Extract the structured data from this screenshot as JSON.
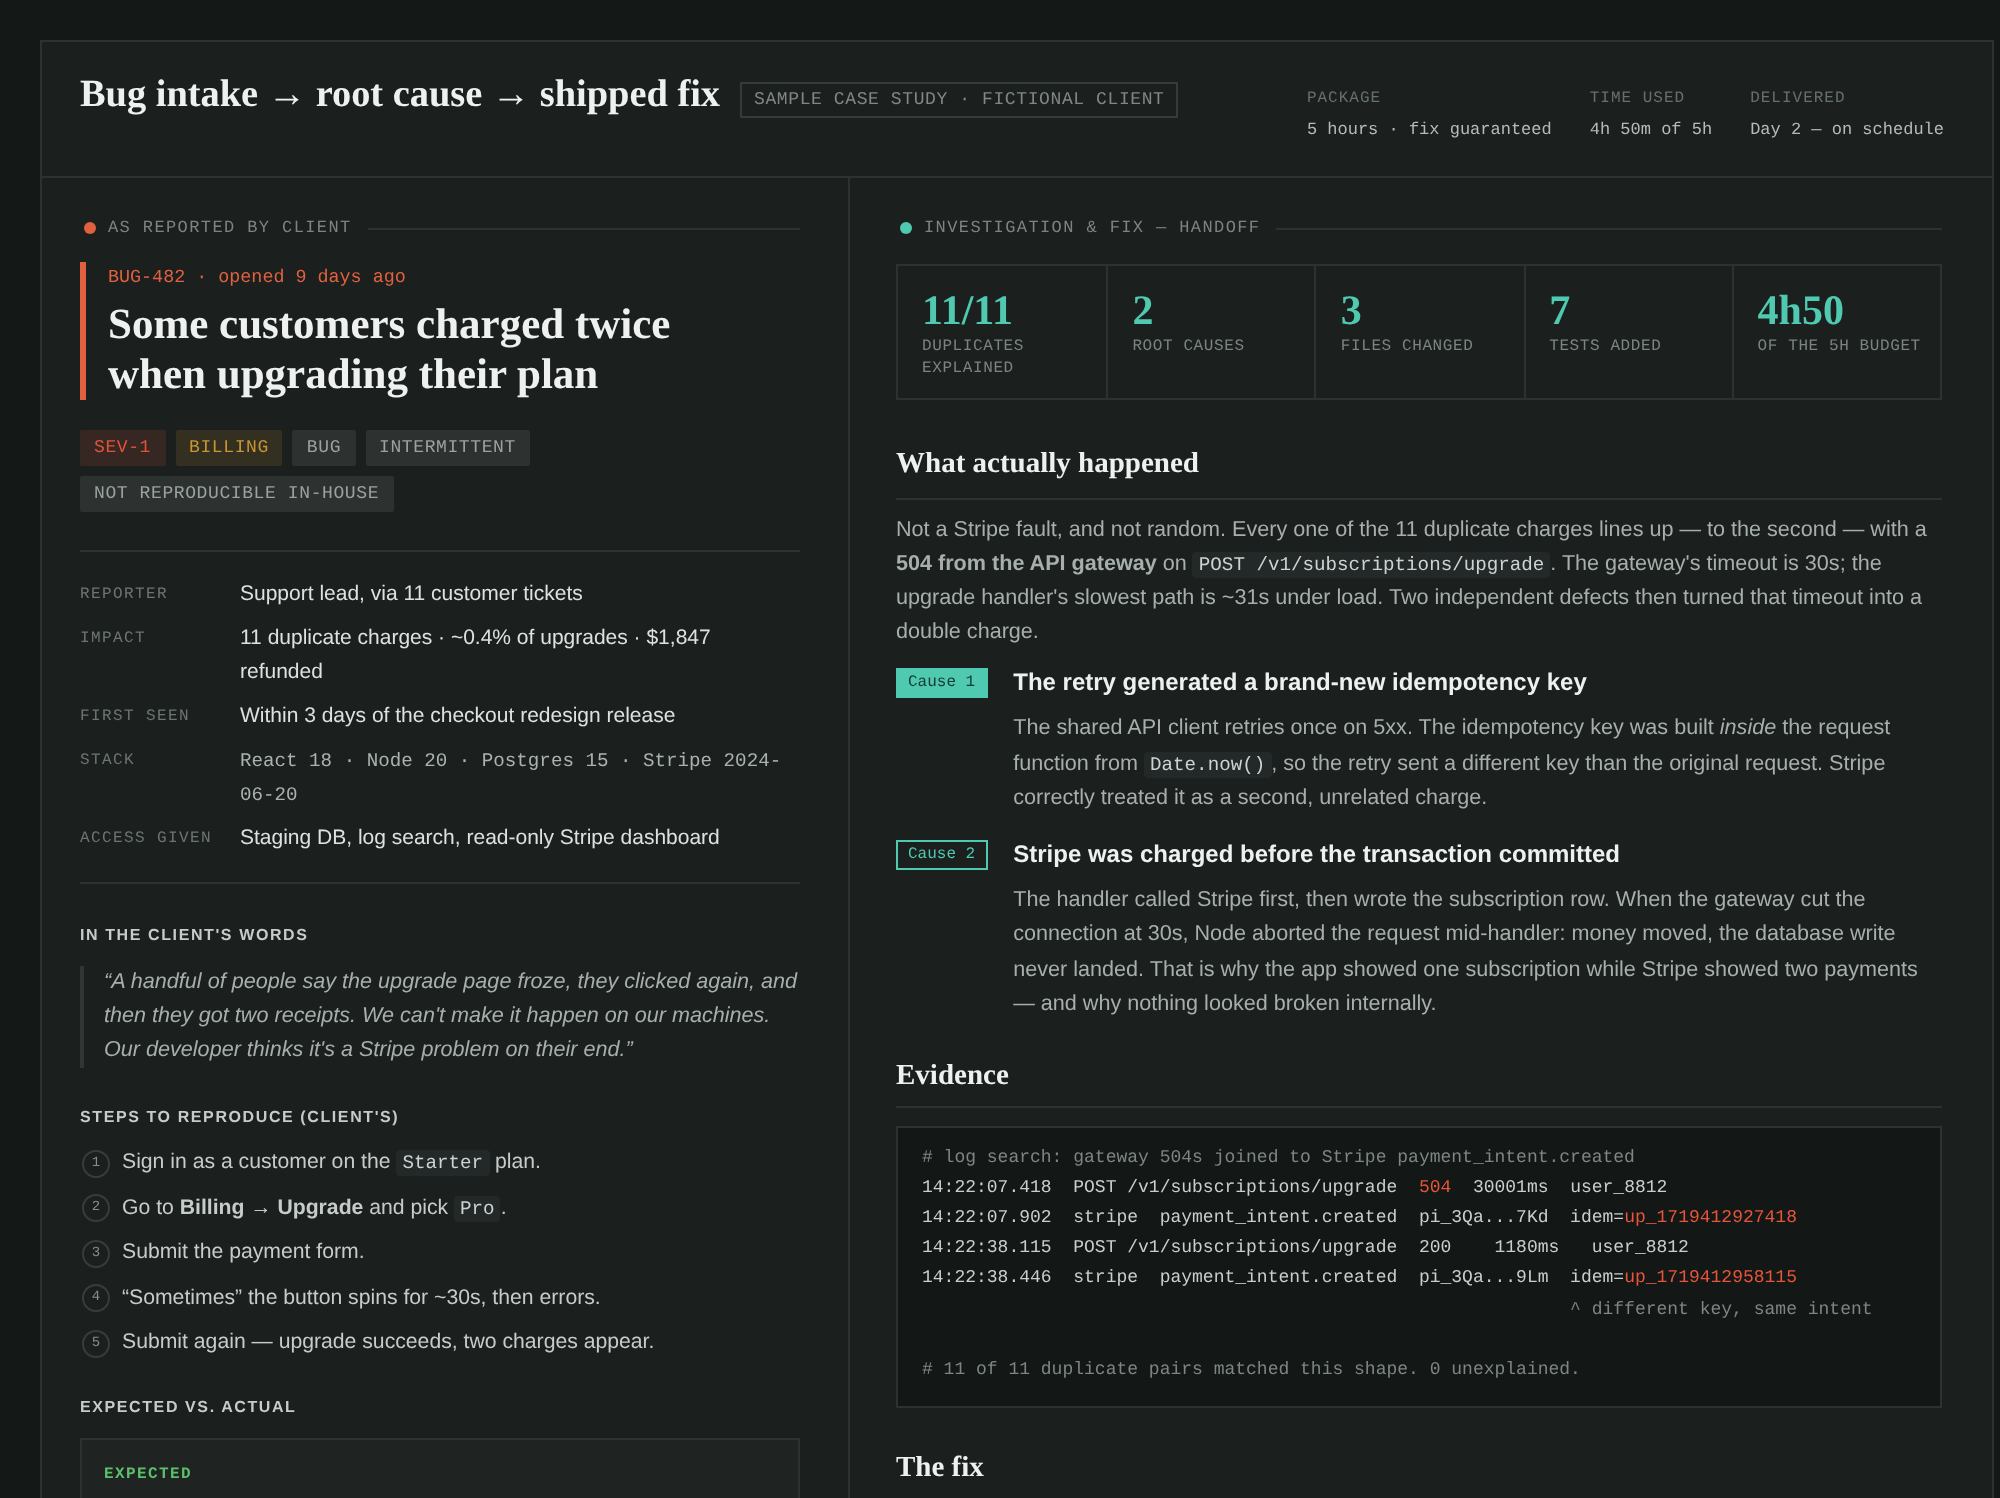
{
  "header": {
    "title": "Bug intake → root cause → shipped fix",
    "badge": "SAMPLE CASE STUDY · FICTIONAL CLIENT",
    "meta": [
      {
        "label": "PACKAGE",
        "value": "5 hours · fix guaranteed"
      },
      {
        "label": "TIME USED",
        "value": "4h 50m of 5h"
      },
      {
        "label": "DELIVERED",
        "value": "Day 2 — on schedule"
      }
    ]
  },
  "report": {
    "section_label": "AS REPORTED BY CLIENT",
    "bug_meta": "BUG-482 · opened 9 days ago",
    "bug_title": "Some customers charged twice when upgrading their plan",
    "tags": [
      {
        "label": "SEV-1",
        "color": "#e0533a"
      },
      {
        "label": "BILLING",
        "color": "#c9962f"
      },
      {
        "label": "BUG",
        "color": "#9aa39f"
      },
      {
        "label": "INTERMITTENT",
        "color": "#9aa39f"
      },
      {
        "label": "NOT REPRODUCIBLE IN-HOUSE",
        "color": "#9aa39f"
      }
    ],
    "fields": [
      {
        "label": "REPORTER",
        "value": "Support lead, via 11 customer tickets",
        "kind": "text"
      },
      {
        "label": "IMPACT",
        "value": "11 duplicate charges · ~0.4% of upgrades · $1,847 refunded",
        "kind": "text"
      },
      {
        "label": "FIRST SEEN",
        "value": "Within 3 days of the checkout redesign release",
        "kind": "text"
      },
      {
        "label": "STACK",
        "value": "React 18 · Node 20 · Postgres 15 · Stripe 2024-06-20",
        "kind": "mono"
      },
      {
        "label": "ACCESS GIVEN",
        "value": "Staging DB, log search, read-only Stripe dashboard",
        "kind": "text"
      }
    ],
    "quote_heading": "IN THE CLIENT'S WORDS",
    "quote": "“A handful of people say the upgrade page froze, they clicked again, and then they got two receipts. We can't make it happen on our machines. Our developer thinks it's a Stripe problem on their end.”",
    "steps_heading": "STEPS TO REPRODUCE (CLIENT'S)",
    "steps": [
      {
        "number": "1",
        "parts": [
          {
            "kind": "text",
            "text": "Sign in as a customer on the "
          },
          {
            "kind": "code",
            "text": "Starter"
          },
          {
            "kind": "text",
            "text": " plan."
          }
        ]
      },
      {
        "number": "2",
        "parts": [
          {
            "kind": "text",
            "text": "Go to **Billing → Upgrade** and pick "
          },
          {
            "kind": "code",
            "text": "Pro"
          },
          {
            "kind": "text",
            "text": "."
          }
        ]
      },
      {
        "number": "3",
        "parts": [
          {
            "kind": "text",
            "text": "Submit the payment form."
          }
        ]
      },
      {
        "number": "4",
        "parts": [
          {
            "kind": "text",
            "text": "“Sometimes” the button spins for ~30s, then errors."
          }
        ]
      },
      {
        "number": "5",
        "parts": [
          {
            "kind": "text",
            "text": "Submit again — upgrade succeeds, two charges appear."
          }
        ]
      }
    ],
    "expected_heading": "EXPECTED VS. ACTUAL",
    "expected_label": "EXPECTED"
  },
  "investigation": {
    "section_label": "INVESTIGATION & FIX — HANDOFF",
    "stats": [
      {
        "value": "11/11",
        "label": "DUPLICATES EXPLAINED"
      },
      {
        "value": "2",
        "label": "ROOT CAUSES"
      },
      {
        "value": "3",
        "label": "FILES CHANGED"
      },
      {
        "value": "7",
        "label": "TESTS ADDED"
      },
      {
        "value": "4h50",
        "label": "OF THE 5H BUDGET"
      }
    ],
    "summary_heading": "What actually happened",
    "summary": [
      {
        "kind": "text",
        "text": "Not a Stripe fault, and not random. Every one of the 11 duplicate charges lines up — to the second — with a **504 from the API gateway** on "
      },
      {
        "kind": "code",
        "text": "POST /v1/subscriptions/upgrade"
      },
      {
        "kind": "text",
        "text": ". The gateway's timeout is 30s; the upgrade handler's slowest path is ~31s under load. Two independent defects then turned that timeout into a double charge."
      }
    ],
    "causes": [
      {
        "badge": "Cause 1",
        "kind": "filled",
        "title": "The retry generated a brand-new idempotency key",
        "body": [
          {
            "kind": "text",
            "text": "The shared API client retries once on 5xx. The idempotency key was built *inside* the request function from "
          },
          {
            "kind": "code",
            "text": "Date.now()"
          },
          {
            "kind": "text",
            "text": ", so the retry sent a different key than the original request. Stripe correctly treated it as a second, unrelated charge."
          }
        ]
      },
      {
        "badge": "Cause 2",
        "kind": "outline",
        "title": "Stripe was charged before the transaction committed",
        "body": [
          {
            "kind": "text",
            "text": "The handler called Stripe first, then wrote the subscription row. When the gateway cut the connection at 30s, Node aborted the request mid-handler: money moved, the database write never landed. That is why the app showed one subscription while Stripe showed two payments — and why nothing looked broken internally."
          }
        ]
      }
    ],
    "evidence_heading": "Evidence",
    "log": [
      {
        "kind": "comment",
        "parts": [
          {
            "text": "# log search: gateway 504s joined to Stripe payment_intent.created",
            "alert": false
          }
        ]
      },
      {
        "kind": "entry",
        "parts": [
          {
            "text": "14:22:07.418  POST /v1/subscriptions/upgrade  ",
            "alert": false
          },
          {
            "text": "504",
            "alert": true
          },
          {
            "text": "  30001ms  user_8812",
            "alert": false
          }
        ]
      },
      {
        "kind": "entry",
        "parts": [
          {
            "text": "14:22:07.902  stripe  payment_intent.created  pi_3Qa...7Kd  idem=",
            "alert": false
          },
          {
            "text": "up_1719412927418",
            "alert": true
          }
        ]
      },
      {
        "kind": "entry",
        "parts": [
          {
            "text": "14:22:38.115  POST /v1/subscriptions/upgrade  200    1180ms   user_8812",
            "alert": false
          }
        ]
      },
      {
        "kind": "entry",
        "parts": [
          {
            "text": "14:22:38.446  stripe  payment_intent.created  pi_3Qa...9Lm  idem=",
            "alert": false
          },
          {
            "text": "up_1719412958115",
            "alert": true
          }
        ]
      },
      {
        "kind": "note",
        "parts": [
          {
            "text": "^ different key, same intent",
            "alert": false
          }
        ]
      },
      {
        "kind": "summary",
        "parts": [
          {
            "text": "# 11 of 11 duplicate pairs matched this shape. 0 unexplained.",
            "alert": false
          }
        ]
      }
    ],
    "fix_heading": "The fix"
  }
}
